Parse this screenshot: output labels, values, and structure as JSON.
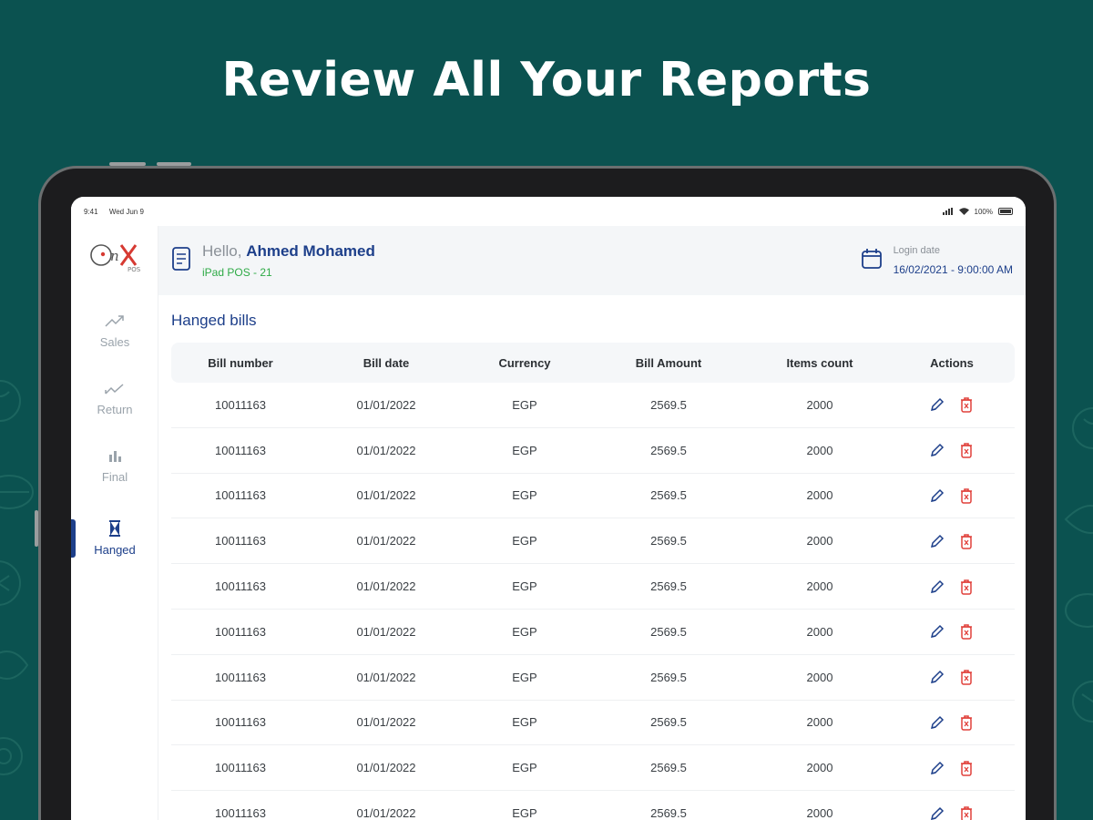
{
  "headline": "Review All Your Reports",
  "colors": {
    "background": "#0b5250",
    "accent": "#1d3f8a",
    "device_label": "#2eaa46",
    "delete": "#e0413b",
    "edit": "#1d3f8a"
  },
  "status_bar": {
    "time": "9:41",
    "date": "Wed Jun 9",
    "battery": "100%"
  },
  "logo": {
    "brand": "OnX",
    "sub": "POS"
  },
  "sidebar": {
    "items": [
      {
        "label": "Sales",
        "icon": "trend-up-icon",
        "active": false
      },
      {
        "label": "Return",
        "icon": "trend-down-icon",
        "active": false
      },
      {
        "label": "Final",
        "icon": "bar-chart-icon",
        "active": false
      },
      {
        "label": "Hanged",
        "icon": "hourglass-icon",
        "active": true
      }
    ]
  },
  "header": {
    "hello": "Hello, ",
    "user_name": "Ahmed Mohamed",
    "device": "iPad POS - 21",
    "login_label": "Login date",
    "login_value": "16/02/2021 - 9:00:00 AM"
  },
  "section_title": "Hanged bills",
  "table": {
    "columns": [
      "Bill number",
      "Bill date",
      "Currency",
      "Bill Amount",
      "Items count",
      "Actions"
    ],
    "rows": [
      {
        "bill_number": "10011163",
        "bill_date": "01/01/2022",
        "currency": "EGP",
        "amount": "2569.5",
        "items": "2000"
      },
      {
        "bill_number": "10011163",
        "bill_date": "01/01/2022",
        "currency": "EGP",
        "amount": "2569.5",
        "items": "2000"
      },
      {
        "bill_number": "10011163",
        "bill_date": "01/01/2022",
        "currency": "EGP",
        "amount": "2569.5",
        "items": "2000"
      },
      {
        "bill_number": "10011163",
        "bill_date": "01/01/2022",
        "currency": "EGP",
        "amount": "2569.5",
        "items": "2000"
      },
      {
        "bill_number": "10011163",
        "bill_date": "01/01/2022",
        "currency": "EGP",
        "amount": "2569.5",
        "items": "2000"
      },
      {
        "bill_number": "10011163",
        "bill_date": "01/01/2022",
        "currency": "EGP",
        "amount": "2569.5",
        "items": "2000"
      },
      {
        "bill_number": "10011163",
        "bill_date": "01/01/2022",
        "currency": "EGP",
        "amount": "2569.5",
        "items": "2000"
      },
      {
        "bill_number": "10011163",
        "bill_date": "01/01/2022",
        "currency": "EGP",
        "amount": "2569.5",
        "items": "2000"
      },
      {
        "bill_number": "10011163",
        "bill_date": "01/01/2022",
        "currency": "EGP",
        "amount": "2569.5",
        "items": "2000"
      },
      {
        "bill_number": "10011163",
        "bill_date": "01/01/2022",
        "currency": "EGP",
        "amount": "2569.5",
        "items": "2000"
      }
    ]
  }
}
